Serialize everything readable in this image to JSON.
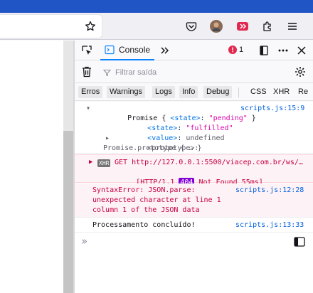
{
  "browser": {
    "colors": {
      "tab_strip": "#1f55c4",
      "toolbar": "#f0f0f4"
    },
    "toolbar_icons": [
      "star-icon",
      "pocket-icon",
      "profile-avatar",
      "extension-red-icon",
      "extensions-puzzle-icon",
      "menu-hamburger-icon"
    ]
  },
  "devtools": {
    "tabs": {
      "console_label": "Console"
    },
    "error_count": "1",
    "filter": {
      "placeholder": "Filtrar saída"
    },
    "levels": [
      "Erros",
      "Warnings",
      "Logs",
      "Info",
      "Debug"
    ],
    "extra_filters": [
      "CSS",
      "XHR",
      "Re"
    ],
    "messages": {
      "promise": {
        "head_a": "Promise { ",
        "head_key": "<state>",
        "head_b": ": ",
        "head_val": "\"pending\"",
        "head_c": " }",
        "source": "scripts.js:15:9",
        "state_key": "<state>",
        "state_val": "\"fulfilled\"",
        "value_key": "<value>",
        "value_val": "undefined",
        "proto_key": "<prototype>",
        "proto_line": "Promise.prototype { … }"
      },
      "xhr": {
        "badge": "XHR",
        "line1": "GET http://127.0.0.1:5500/viacep.com.br/ws/…",
        "line2_a": "[HTTP/1.1 ",
        "status": "404",
        "line2_b": " Not Found 55ms]"
      },
      "syntax_error": {
        "line1": "SyntaxError: JSON.parse:",
        "line2": "unexpected character at line 1",
        "line3": "column 1 of the JSON data",
        "source": "scripts.js:12:28"
      },
      "info": {
        "text": "Processamento concluído!",
        "source": "scripts.js:13:33"
      }
    },
    "prompt_symbol": "»"
  }
}
